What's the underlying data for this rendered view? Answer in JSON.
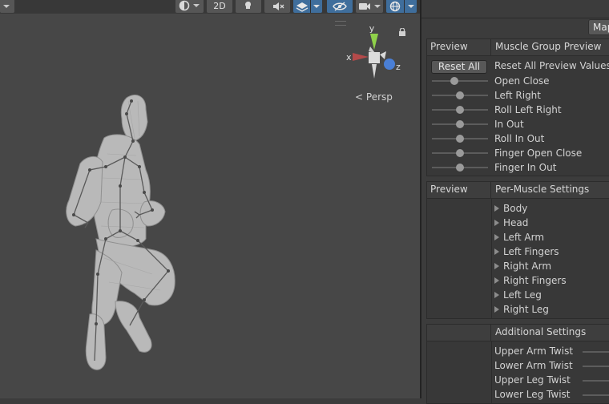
{
  "toolbar": {
    "twod_label": "2D"
  },
  "gizmo": {
    "x_label": "x",
    "y_label": "y",
    "z_label": "z",
    "projection_label": "Persp",
    "colors": {
      "x": "#b44a4a",
      "y": "#8fd14a",
      "z": "#4a7fd6"
    }
  },
  "inspector": {
    "mapping_label": "Mapping",
    "preview_panel": {
      "col1_header": "Preview",
      "col2_header": "Muscle Group Preview",
      "reset_label": "Reset All",
      "reset_desc": "Reset All Preview Values",
      "rows": [
        {
          "label": "Open Close",
          "value": 0.4
        },
        {
          "label": "Left Right",
          "value": 0.5
        },
        {
          "label": "Roll Left Right",
          "value": 0.5
        },
        {
          "label": "In Out",
          "value": 0.5
        },
        {
          "label": "Roll In Out",
          "value": 0.5
        },
        {
          "label": "Finger Open Close",
          "value": 0.5
        },
        {
          "label": "Finger In Out",
          "value": 0.5
        }
      ]
    },
    "per_muscle_panel": {
      "col1_header": "Preview",
      "col2_header": "Per-Muscle Settings",
      "groups": [
        "Body",
        "Head",
        "Left Arm",
        "Left Fingers",
        "Right Arm",
        "Right Fingers",
        "Left Leg",
        "Right Leg"
      ]
    },
    "additional_panel": {
      "header": "Additional Settings",
      "rows": [
        "Upper Arm Twist",
        "Lower Arm Twist",
        "Upper Leg Twist",
        "Lower Leg Twist"
      ]
    }
  }
}
